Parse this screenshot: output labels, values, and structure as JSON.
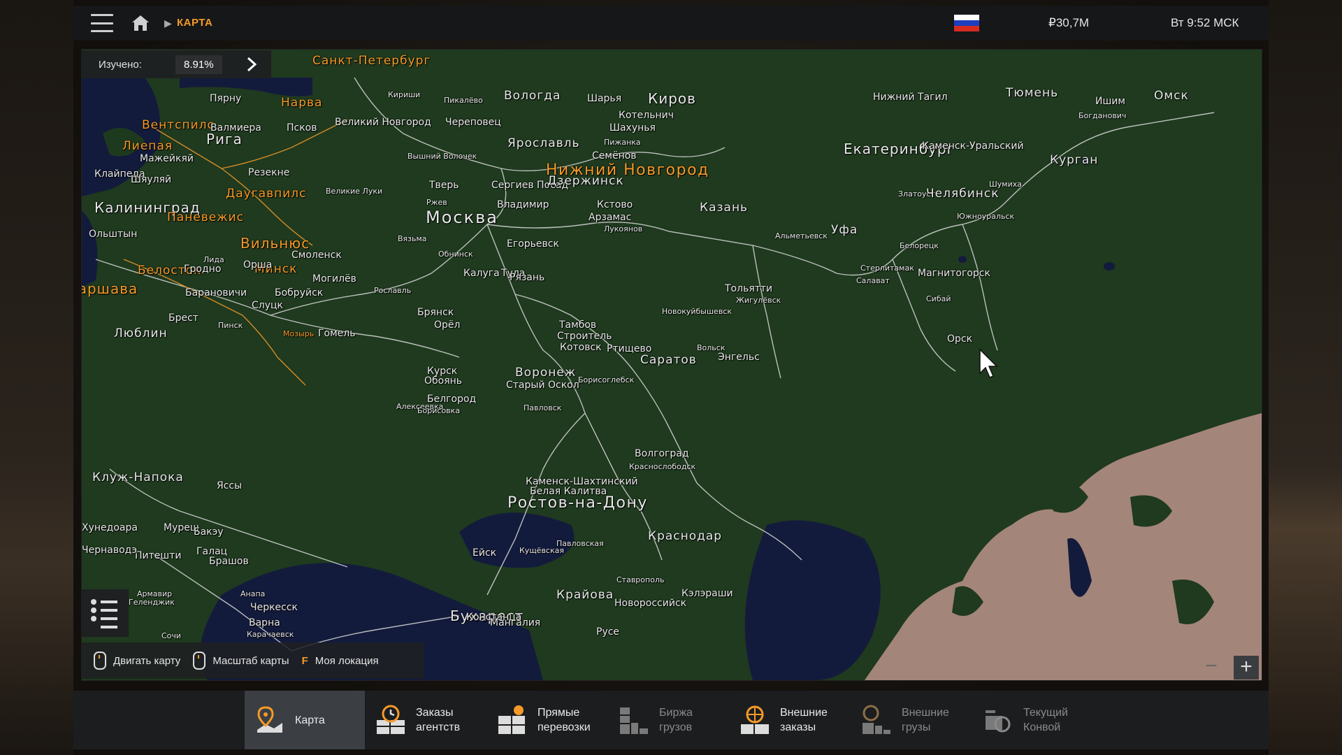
{
  "header": {
    "breadcrumb": "КАРТА",
    "money": "₽30,7M",
    "clock": "Вт 9:52 МСК",
    "flag_colors": [
      "#ffffff",
      "#1c3fbf",
      "#d52b1e"
    ]
  },
  "map": {
    "explored_label": "Изучено:",
    "explored_value": "8.91%",
    "explored_fraction": 0.0891,
    "cities": [
      {
        "name": "Санкт-Петербург",
        "style": "orange city-m"
      },
      {
        "name": "Вологда",
        "style": "city-m"
      },
      {
        "name": "Шарья",
        "style": "city-s"
      },
      {
        "name": "Киров",
        "style": "city-l"
      },
      {
        "name": "Нижний Тагил",
        "style": "city-s"
      },
      {
        "name": "Тюмень",
        "style": "city-m"
      },
      {
        "name": "Омск",
        "style": "city-m"
      },
      {
        "name": "Пярну",
        "style": "city-s"
      },
      {
        "name": "Нарва",
        "style": "orange city-m"
      },
      {
        "name": "Кириши",
        "style": "city-xs"
      },
      {
        "name": "Пикалёво",
        "style": "city-xs"
      },
      {
        "name": "Котельнич",
        "style": "city-s"
      },
      {
        "name": "Ишим",
        "style": "city-s"
      },
      {
        "name": "Вентспилс",
        "style": "orange city-m"
      },
      {
        "name": "Валмиера",
        "style": "city-s"
      },
      {
        "name": "Псков",
        "style": "city-s"
      },
      {
        "name": "Великий Новгород",
        "style": "city-s"
      },
      {
        "name": "Череповец",
        "style": "city-s"
      },
      {
        "name": "Шахунья",
        "style": "city-s"
      },
      {
        "name": "Богданович",
        "style": "city-xs"
      },
      {
        "name": "Лиепая",
        "style": "orange city-m"
      },
      {
        "name": "Рига",
        "style": "city-l"
      },
      {
        "name": "Ярославль",
        "style": "city-m"
      },
      {
        "name": "Пижанка",
        "style": "city-xs"
      },
      {
        "name": "Екатеринбург",
        "style": "city-l"
      },
      {
        "name": "Каменск-Уральский",
        "style": "city-s"
      },
      {
        "name": "Курган",
        "style": "city-m"
      },
      {
        "name": "Мажейкяй",
        "style": "city-s"
      },
      {
        "name": "Вышний Волочек",
        "style": "city-xs"
      },
      {
        "name": "Семёнов",
        "style": "city-s"
      },
      {
        "name": "Нижний Новгород",
        "style": "orange big"
      },
      {
        "name": "Клайпеда",
        "style": "city-s"
      },
      {
        "name": "Шяуляй",
        "style": "city-s"
      },
      {
        "name": "Резекне",
        "style": "city-s"
      },
      {
        "name": "Тверь",
        "style": "city-s"
      },
      {
        "name": "Сергиев Посад",
        "style": "city-s"
      },
      {
        "name": "Дзержинск",
        "style": "city-m"
      },
      {
        "name": "Шумиха",
        "style": "city-xs"
      },
      {
        "name": "Даугавпилс",
        "style": "orange city-m"
      },
      {
        "name": "Великие Луки",
        "style": "city-xs"
      },
      {
        "name": "Златоуст",
        "style": "city-xs"
      },
      {
        "name": "Челябинск",
        "style": "city-m"
      },
      {
        "name": "Калининград",
        "style": "city-l"
      },
      {
        "name": "Ржев",
        "style": "city-xs"
      },
      {
        "name": "Владимир",
        "style": "city-s"
      },
      {
        "name": "Кстово",
        "style": "city-s"
      },
      {
        "name": "Казань",
        "style": "city-m"
      },
      {
        "name": "Паневежис",
        "style": "orange city-m"
      },
      {
        "name": "Москва",
        "style": "huge"
      },
      {
        "name": "Арзамас",
        "style": "city-s"
      },
      {
        "name": "Уфа",
        "style": "city-m"
      },
      {
        "name": "Южноуральск",
        "style": "city-xs"
      },
      {
        "name": "Ольштын",
        "style": "city-s"
      },
      {
        "name": "Лукоянов",
        "style": "city-xs"
      },
      {
        "name": "Альметьевск",
        "style": "city-xs"
      },
      {
        "name": "Вильнюс",
        "style": "orange city-l"
      },
      {
        "name": "Вязьма",
        "style": "city-xs"
      },
      {
        "name": "Егорьевск",
        "style": "city-s"
      },
      {
        "name": "Белорецк",
        "style": "city-xs"
      },
      {
        "name": "Лида",
        "style": "city-xs"
      },
      {
        "name": "Смоленск",
        "style": "city-s"
      },
      {
        "name": "Обнинск",
        "style": "city-xs"
      },
      {
        "name": "Стерлитамак",
        "style": "city-xs"
      },
      {
        "name": "Магнитогорск",
        "style": "city-s"
      },
      {
        "name": "Белосток",
        "style": "orange city-m"
      },
      {
        "name": "Гродно",
        "style": "city-s"
      },
      {
        "name": "Минск",
        "style": "orange city-m"
      },
      {
        "name": "Орша",
        "style": "city-s"
      },
      {
        "name": "Калуга",
        "style": "city-s"
      },
      {
        "name": "Тула",
        "style": "city-s"
      },
      {
        "name": "Рязань",
        "style": "city-s"
      },
      {
        "name": "Варшава",
        "style": "orange city-l"
      },
      {
        "name": "Могилёв",
        "style": "city-s"
      },
      {
        "name": "Рославль",
        "style": "city-xs"
      },
      {
        "name": "Тольятти",
        "style": "city-s"
      },
      {
        "name": "Жигулёвск",
        "style": "city-xs"
      },
      {
        "name": "Салават",
        "style": "city-xs"
      },
      {
        "name": "Барановичи",
        "style": "city-s"
      },
      {
        "name": "Бобруйск",
        "style": "city-s"
      },
      {
        "name": "Слуцк",
        "style": "city-s"
      },
      {
        "name": "Брянск",
        "style": "city-s"
      },
      {
        "name": "Новокуйбышевск",
        "style": "city-xs"
      },
      {
        "name": "Сибай",
        "style": "city-xs"
      },
      {
        "name": "Брест",
        "style": "city-s"
      },
      {
        "name": "Пинск",
        "style": "city-xs"
      },
      {
        "name": "Орёл",
        "style": "city-s"
      },
      {
        "name": "Тамбов",
        "style": "city-s"
      },
      {
        "name": "Строитель",
        "style": "city-s"
      },
      {
        "name": "Люблин",
        "style": "city-m"
      },
      {
        "name": "Мозырь",
        "style": "orange city-xs"
      },
      {
        "name": "Гомель",
        "style": "city-s"
      },
      {
        "name": "Котовск",
        "style": "city-s"
      },
      {
        "name": "Ртищево",
        "style": "city-s"
      },
      {
        "name": "Вольск",
        "style": "city-xs"
      },
      {
        "name": "Орск",
        "style": "city-s"
      },
      {
        "name": "Саратов",
        "style": "city-m"
      },
      {
        "name": "Энгельс",
        "style": "city-s"
      },
      {
        "name": "Курск",
        "style": "city-s"
      },
      {
        "name": "Воронеж",
        "style": "city-m"
      },
      {
        "name": "Обоянь",
        "style": "city-s"
      },
      {
        "name": "Старый Оскол",
        "style": "city-s"
      },
      {
        "name": "Борисоглебск",
        "style": "city-xs"
      },
      {
        "name": "Белгород",
        "style": "city-s"
      },
      {
        "name": "Алексеевка",
        "style": "city-xs"
      },
      {
        "name": "Борисовка",
        "style": "city-xs"
      },
      {
        "name": "Павловск",
        "style": "city-xs"
      },
      {
        "name": "Волгоград",
        "style": "city-s"
      },
      {
        "name": "Краснослободск",
        "style": "city-xs"
      },
      {
        "name": "Каменск-Шахтинский",
        "style": "city-s"
      },
      {
        "name": "Белая Калитва",
        "style": "city-s"
      },
      {
        "name": "Ростов-на-Дону",
        "style": "big"
      },
      {
        "name": "Клуж-Напока",
        "style": "city-m"
      },
      {
        "name": "Яссы",
        "style": "city-s"
      },
      {
        "name": "Ейск",
        "style": "city-s"
      },
      {
        "name": "Кущёвская",
        "style": "city-xs"
      },
      {
        "name": "Хунедоара",
        "style": "city-s"
      },
      {
        "name": "Муреш",
        "style": "city-s"
      },
      {
        "name": "Бакэу",
        "style": "city-s"
      },
      {
        "name": "Галац",
        "style": "city-s"
      },
      {
        "name": "Брашов",
        "style": "city-s"
      },
      {
        "name": "Питешти",
        "style": "city-s"
      },
      {
        "name": "Павловская",
        "style": "city-xs"
      },
      {
        "name": "Краснодар",
        "style": "city-m"
      },
      {
        "name": "Ставрополь",
        "style": "city-xs"
      },
      {
        "name": "Крайова",
        "style": "city-m"
      },
      {
        "name": "Кэлэраши",
        "style": "city-s"
      },
      {
        "name": "Чернаводэ",
        "style": "city-s"
      },
      {
        "name": "Армавир",
        "style": "city-xs"
      },
      {
        "name": "Анапа",
        "style": "city-xs"
      },
      {
        "name": "Новороссийск",
        "style": "city-s"
      },
      {
        "name": "Бухарест",
        "style": "city-l"
      },
      {
        "name": "Констанца",
        "style": "city-s"
      },
      {
        "name": "Геленджик",
        "style": "city-xs"
      },
      {
        "name": "Черкесск",
        "style": "city-s"
      },
      {
        "name": "Мангалия",
        "style": "city-s"
      },
      {
        "name": "Русе",
        "style": "city-s"
      },
      {
        "name": "Варна",
        "style": "city-s"
      },
      {
        "name": "Сочи",
        "style": "city-xs"
      },
      {
        "name": "Карачаевск",
        "style": "city-xs"
      }
    ]
  },
  "hints": {
    "move_map": "Двигать карту",
    "zoom_map": "Масштаб карты",
    "my_location_key": "F",
    "my_location": "Моя локация"
  },
  "zoom": {
    "minus": "−",
    "plus": "+"
  },
  "nav": [
    {
      "label": "Карта",
      "active": true,
      "dim": false
    },
    {
      "label": "Заказы\nагентств",
      "active": false,
      "dim": false
    },
    {
      "label": "Прямые\nперевозки",
      "active": false,
      "dim": false
    },
    {
      "label": "Биржа\nгрузов",
      "active": false,
      "dim": true
    },
    {
      "label": "Внешние\nзаказы",
      "active": false,
      "dim": false
    },
    {
      "label": "Внешние\nгрузы",
      "active": false,
      "dim": true
    },
    {
      "label": "Текущий\nКонвой",
      "active": false,
      "dim": true
    }
  ]
}
